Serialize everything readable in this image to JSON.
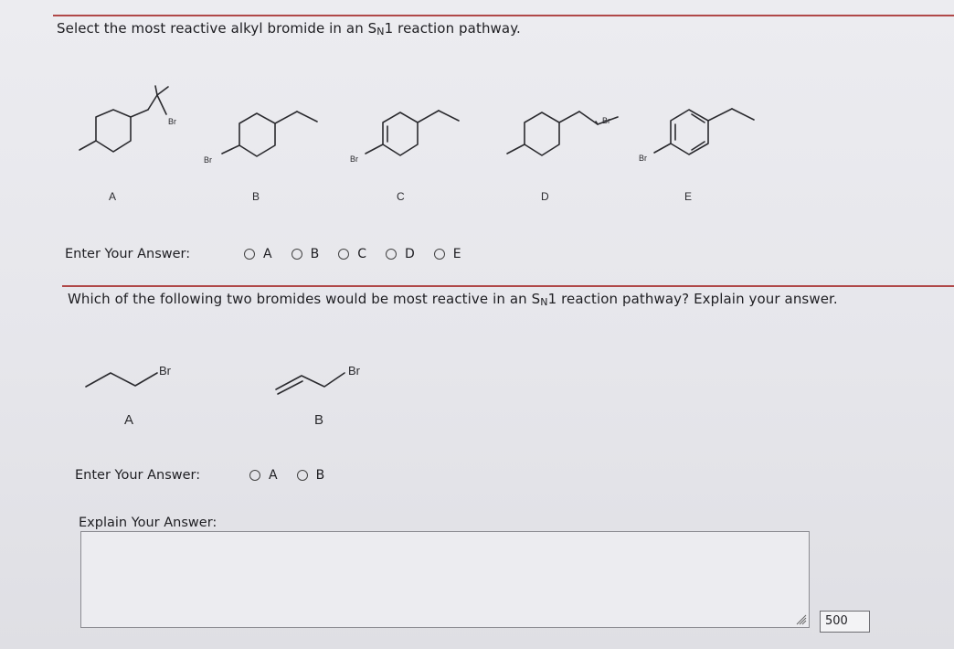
{
  "question1": {
    "prompt_before": "Select the most reactive alkyl bromide in an S",
    "prompt_sub": "N",
    "prompt_after": "1 reaction pathway.",
    "molecules": [
      {
        "label": "A",
        "atom": "Br"
      },
      {
        "label": "B",
        "atom": "Br"
      },
      {
        "label": "C",
        "atom": "Br"
      },
      {
        "label": "D",
        "atom": "Br"
      },
      {
        "label": "E",
        "atom": "Br"
      }
    ],
    "answer_label": "Enter Your Answer:",
    "options": [
      "A",
      "B",
      "C",
      "D",
      "E"
    ]
  },
  "question2": {
    "prompt_before": "Which of the following two bromides would be most reactive in an S",
    "prompt_sub": "N",
    "prompt_after": "1 reaction pathway? Explain your answer.",
    "molecules": [
      {
        "label": "A",
        "atom": "Br"
      },
      {
        "label": "B",
        "atom": "Br"
      }
    ],
    "answer_label": "Enter Your Answer:",
    "options": [
      "A",
      "B"
    ],
    "explain_label": "Explain Your Answer:",
    "explain_value": "",
    "char_count": "500"
  },
  "colors": {
    "rule": "#b04848",
    "background": "#e8e8ec",
    "ink": "#1e1e22"
  }
}
